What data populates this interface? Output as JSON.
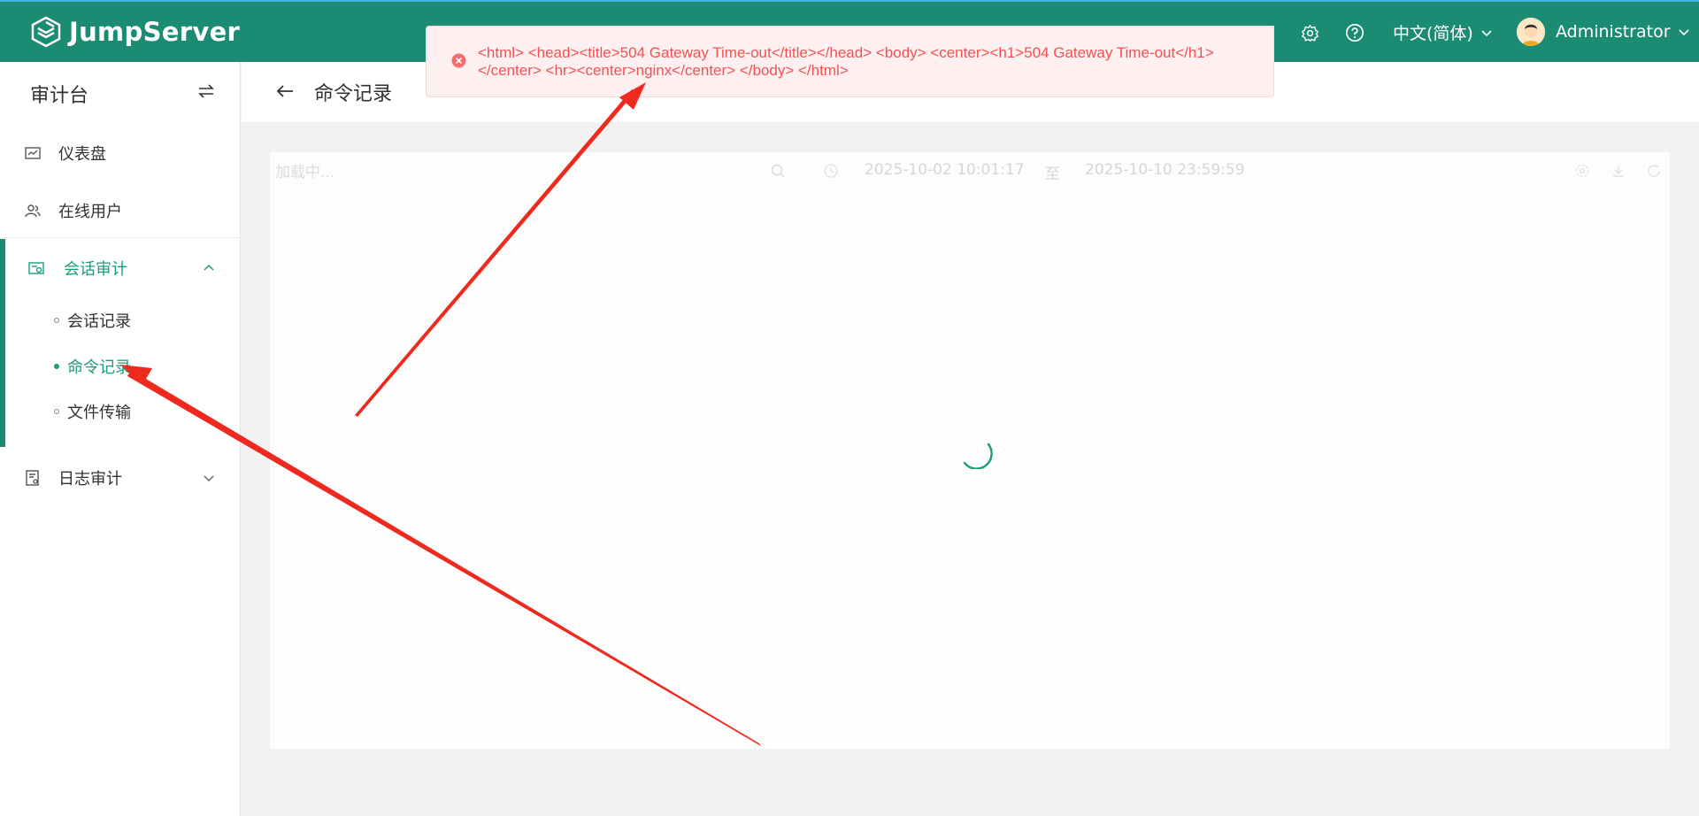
{
  "app": {
    "brand": "JumpServer",
    "language": "中文(简体)",
    "user": "Administrator"
  },
  "sidebar": {
    "title": "审计台",
    "items": [
      {
        "label": "仪表盘",
        "icon": "dashboard-icon"
      },
      {
        "label": "在线用户",
        "icon": "users-icon"
      },
      {
        "label": "会话审计",
        "icon": "session-icon",
        "expanded": true
      },
      {
        "label": "日志审计",
        "icon": "log-icon",
        "expanded": false
      }
    ],
    "session_sub_items": [
      {
        "label": "会话记录",
        "active": false
      },
      {
        "label": "命令记录",
        "active": true
      },
      {
        "label": "文件传输",
        "active": false
      }
    ]
  },
  "page": {
    "title": "命令记录"
  },
  "toolbar": {
    "search_placeholder": "加载中...",
    "date_from": "2025-10-02 10:01:17",
    "date_sep": "至",
    "date_to": "2025-10-10 23:59:59"
  },
  "alert": {
    "type": "error",
    "message": "<html> <head><title>504 Gateway Time-out</title></head> <body> <center><h1>504 Gateway Time-out</h1></center> <hr><center>nginx</center> </body> </html>"
  },
  "colors": {
    "brand": "#1c8b74",
    "active": "#1c9c7e",
    "error": "#f05252",
    "arrow": "#ee2a1f"
  }
}
